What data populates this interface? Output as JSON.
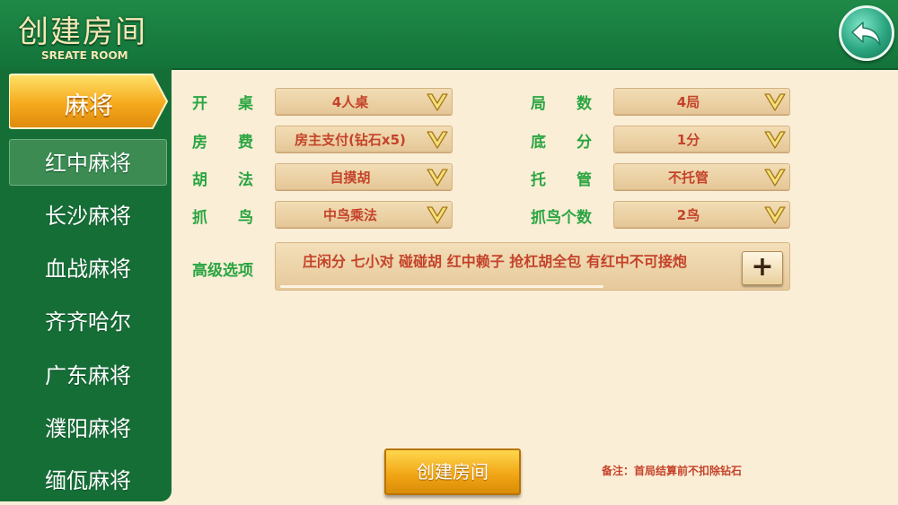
{
  "header": {
    "title": "创建房间",
    "subtitle": "SREATE ROOM"
  },
  "sidebar": {
    "active_tab": "麻将",
    "items": [
      {
        "label": "红中麻将",
        "selected": true
      },
      {
        "label": "长沙麻将",
        "selected": false
      },
      {
        "label": "血战麻将",
        "selected": false
      },
      {
        "label": "齐齐哈尔",
        "selected": false
      },
      {
        "label": "广东麻将",
        "selected": false
      },
      {
        "label": "濮阳麻将",
        "selected": false
      },
      {
        "label": "缅佤麻将",
        "selected": false
      }
    ]
  },
  "form": {
    "table": {
      "label": "开　　桌",
      "value": "4人桌"
    },
    "fee": {
      "label": "房　　费",
      "value": "房主支付(钻石x5)"
    },
    "hu": {
      "label": "胡　　法",
      "value": "自摸胡"
    },
    "bird": {
      "label": "抓　　鸟",
      "value": "中鸟乘法"
    },
    "rounds": {
      "label": "局　　数",
      "value": "4局"
    },
    "base": {
      "label": "底　　分",
      "value": "1分"
    },
    "auto": {
      "label": "托　　管",
      "value": "不托管"
    },
    "bird_count": {
      "label": "抓鸟个数",
      "value": "2鸟"
    },
    "advanced": {
      "label": "高级选项",
      "value": "庄闲分 七小对 碰碰胡 红中赖子 抢杠胡全包 有红中不可接炮",
      "add_label": "+"
    }
  },
  "footer": {
    "create_label": "创建房间",
    "note": "备注：首局结算前不扣除钻石"
  },
  "colors": {
    "header_green": "#13733a",
    "sidebar_green": "#166e37",
    "label_green": "#2aa542",
    "value_red": "#c4432a",
    "gold": "#f0a313"
  }
}
